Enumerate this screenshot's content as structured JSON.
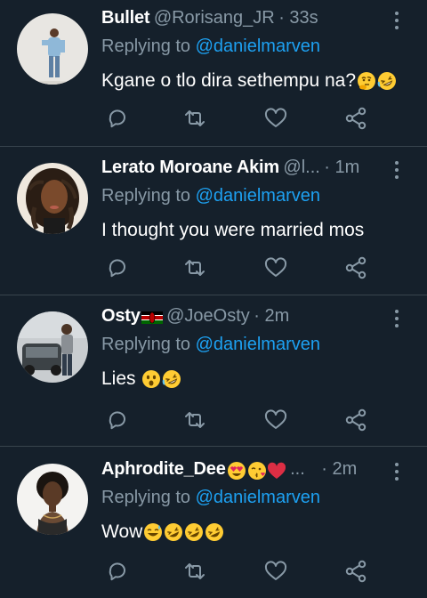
{
  "tweets": [
    {
      "name": "Bullet",
      "handle": "@Rorisang_JR",
      "time": "· 33s",
      "reply_prefix": "Replying to ",
      "reply_to": "@danielmarven",
      "text": "Kgane o tlo dira sethempu na?",
      "emojis": [
        "thinking-face",
        "rofl"
      ]
    },
    {
      "name": "Lerato Moroane Akim",
      "handle": "@l...",
      "time": "· 1m",
      "reply_prefix": "Replying to ",
      "reply_to": "@danielmarven",
      "text": "I thought you were married mos",
      "emojis": []
    },
    {
      "name": "Osty",
      "name_emojis": [
        "kenya-flag"
      ],
      "handle": "@JoeOsty",
      "time": "· 2m",
      "reply_prefix": "Replying to ",
      "reply_to": "@danielmarven",
      "text": "Lies",
      "emojis": [
        "astonished-face",
        "rofl"
      ]
    },
    {
      "name": "Aphrodite_Dee",
      "name_emojis": [
        "heart-eyes",
        "kissing-face",
        "red-heart"
      ],
      "handle": "...",
      "time": "· 2m",
      "reply_prefix": "Replying to ",
      "reply_to": "@danielmarven",
      "text": "Wow",
      "emojis": [
        "sweat-smile",
        "rofl",
        "rofl",
        "rofl"
      ]
    }
  ],
  "icons": [
    "reply-icon",
    "retweet-icon",
    "like-icon",
    "share-icon",
    "more-icon"
  ],
  "colors": {
    "background": "#15202b",
    "secondary_text": "#8899a6",
    "mention": "#1da1f2",
    "divider": "#38444d"
  }
}
